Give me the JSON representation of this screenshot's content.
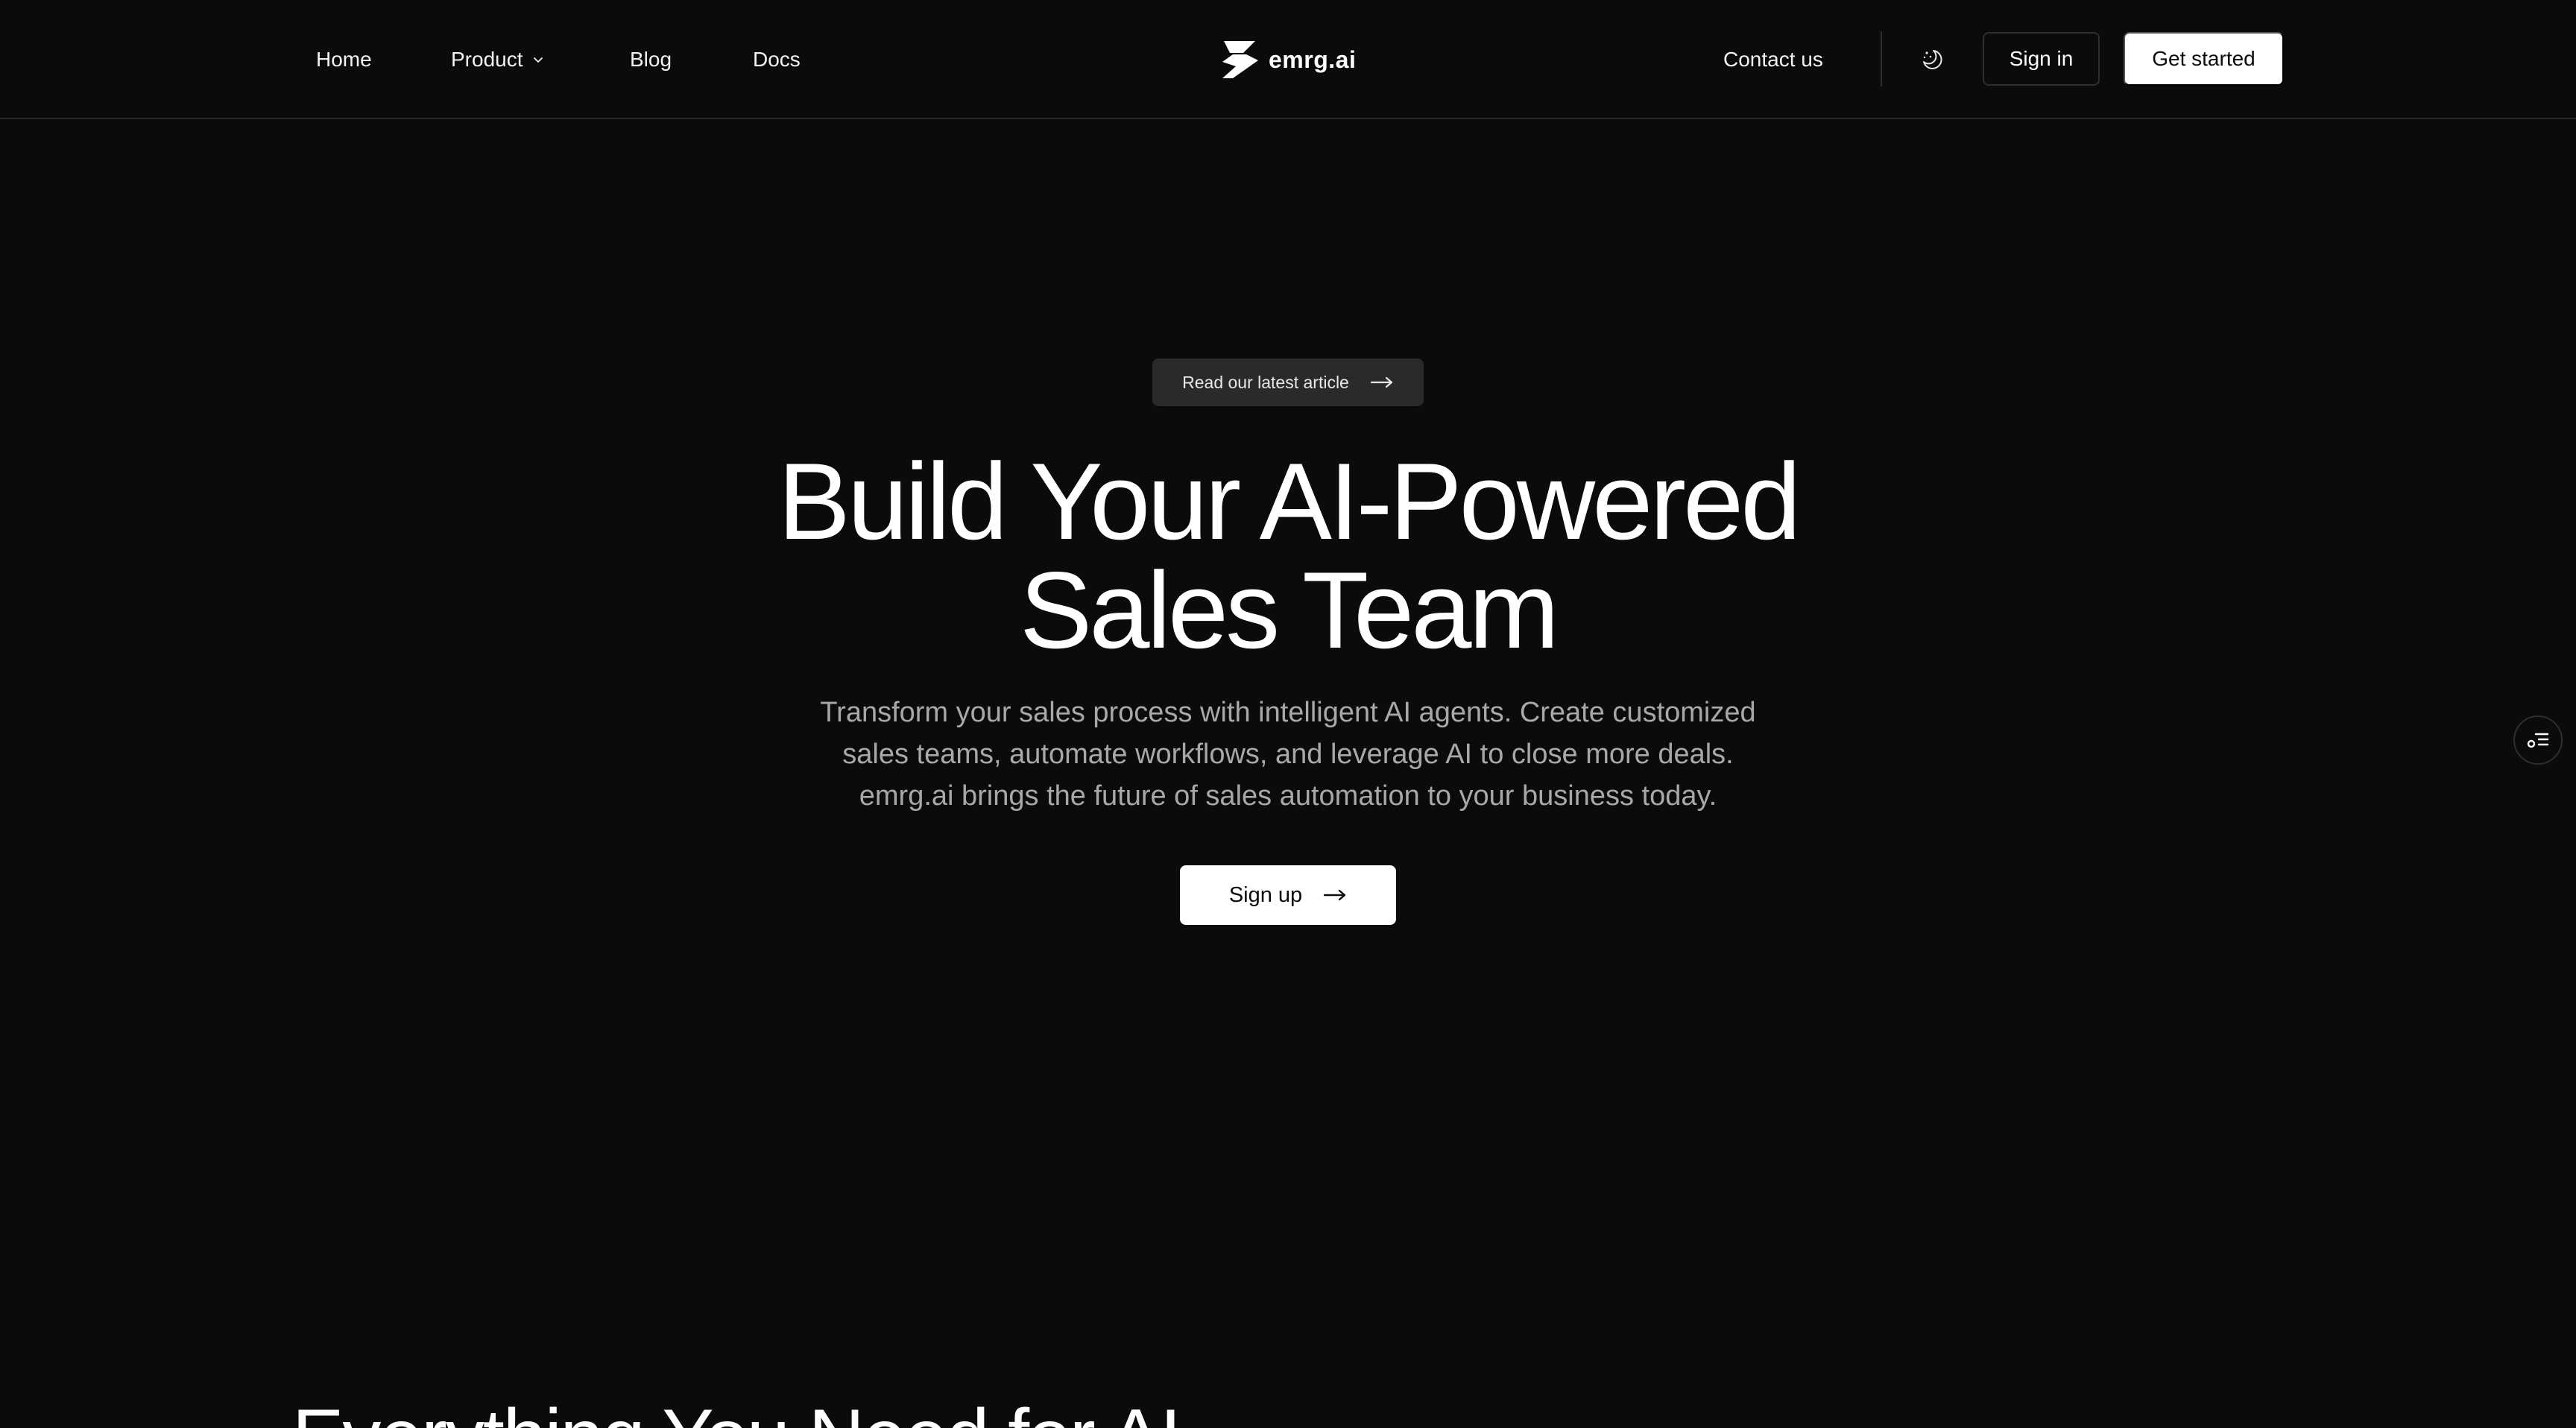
{
  "nav": {
    "links": [
      {
        "label": "Home"
      },
      {
        "label": "Product"
      },
      {
        "label": "Blog"
      },
      {
        "label": "Docs"
      }
    ],
    "product_icon": "chevron-down-icon",
    "brand": {
      "name": "emrg.ai",
      "logo_icon": "emrg-logo-icon"
    },
    "contact_label": "Contact us",
    "theme_toggle_icon": "moon-stars-icon",
    "signin_label": "Sign in",
    "getstarted_label": "Get started"
  },
  "hero": {
    "badge_label": "Read our latest article",
    "badge_icon": "arrow-right-icon",
    "title_lines": [
      "Build Your AI-Powered",
      "Sales Team"
    ],
    "subtitle_lines": [
      "Transform your sales process with intelligent AI agents. Create customized",
      "sales teams, automate workflows, and leverage AI to close more deals.",
      "emrg.ai brings the future of sales automation to your business today."
    ],
    "cta_label": "Sign up",
    "cta_icon": "arrow-right-icon"
  },
  "floating_widget": {
    "icon": "toc-list-icon"
  },
  "next_section": {
    "title": "Everything You Need for AI"
  },
  "colors": {
    "background": "#0b0b0b",
    "text": "#ffffff",
    "muted_text": "#a8a8a8",
    "badge_bg": "#2a2a2a",
    "border": "#262626",
    "primary_button_bg": "#ffffff",
    "primary_button_text": "#0b0b0b"
  }
}
